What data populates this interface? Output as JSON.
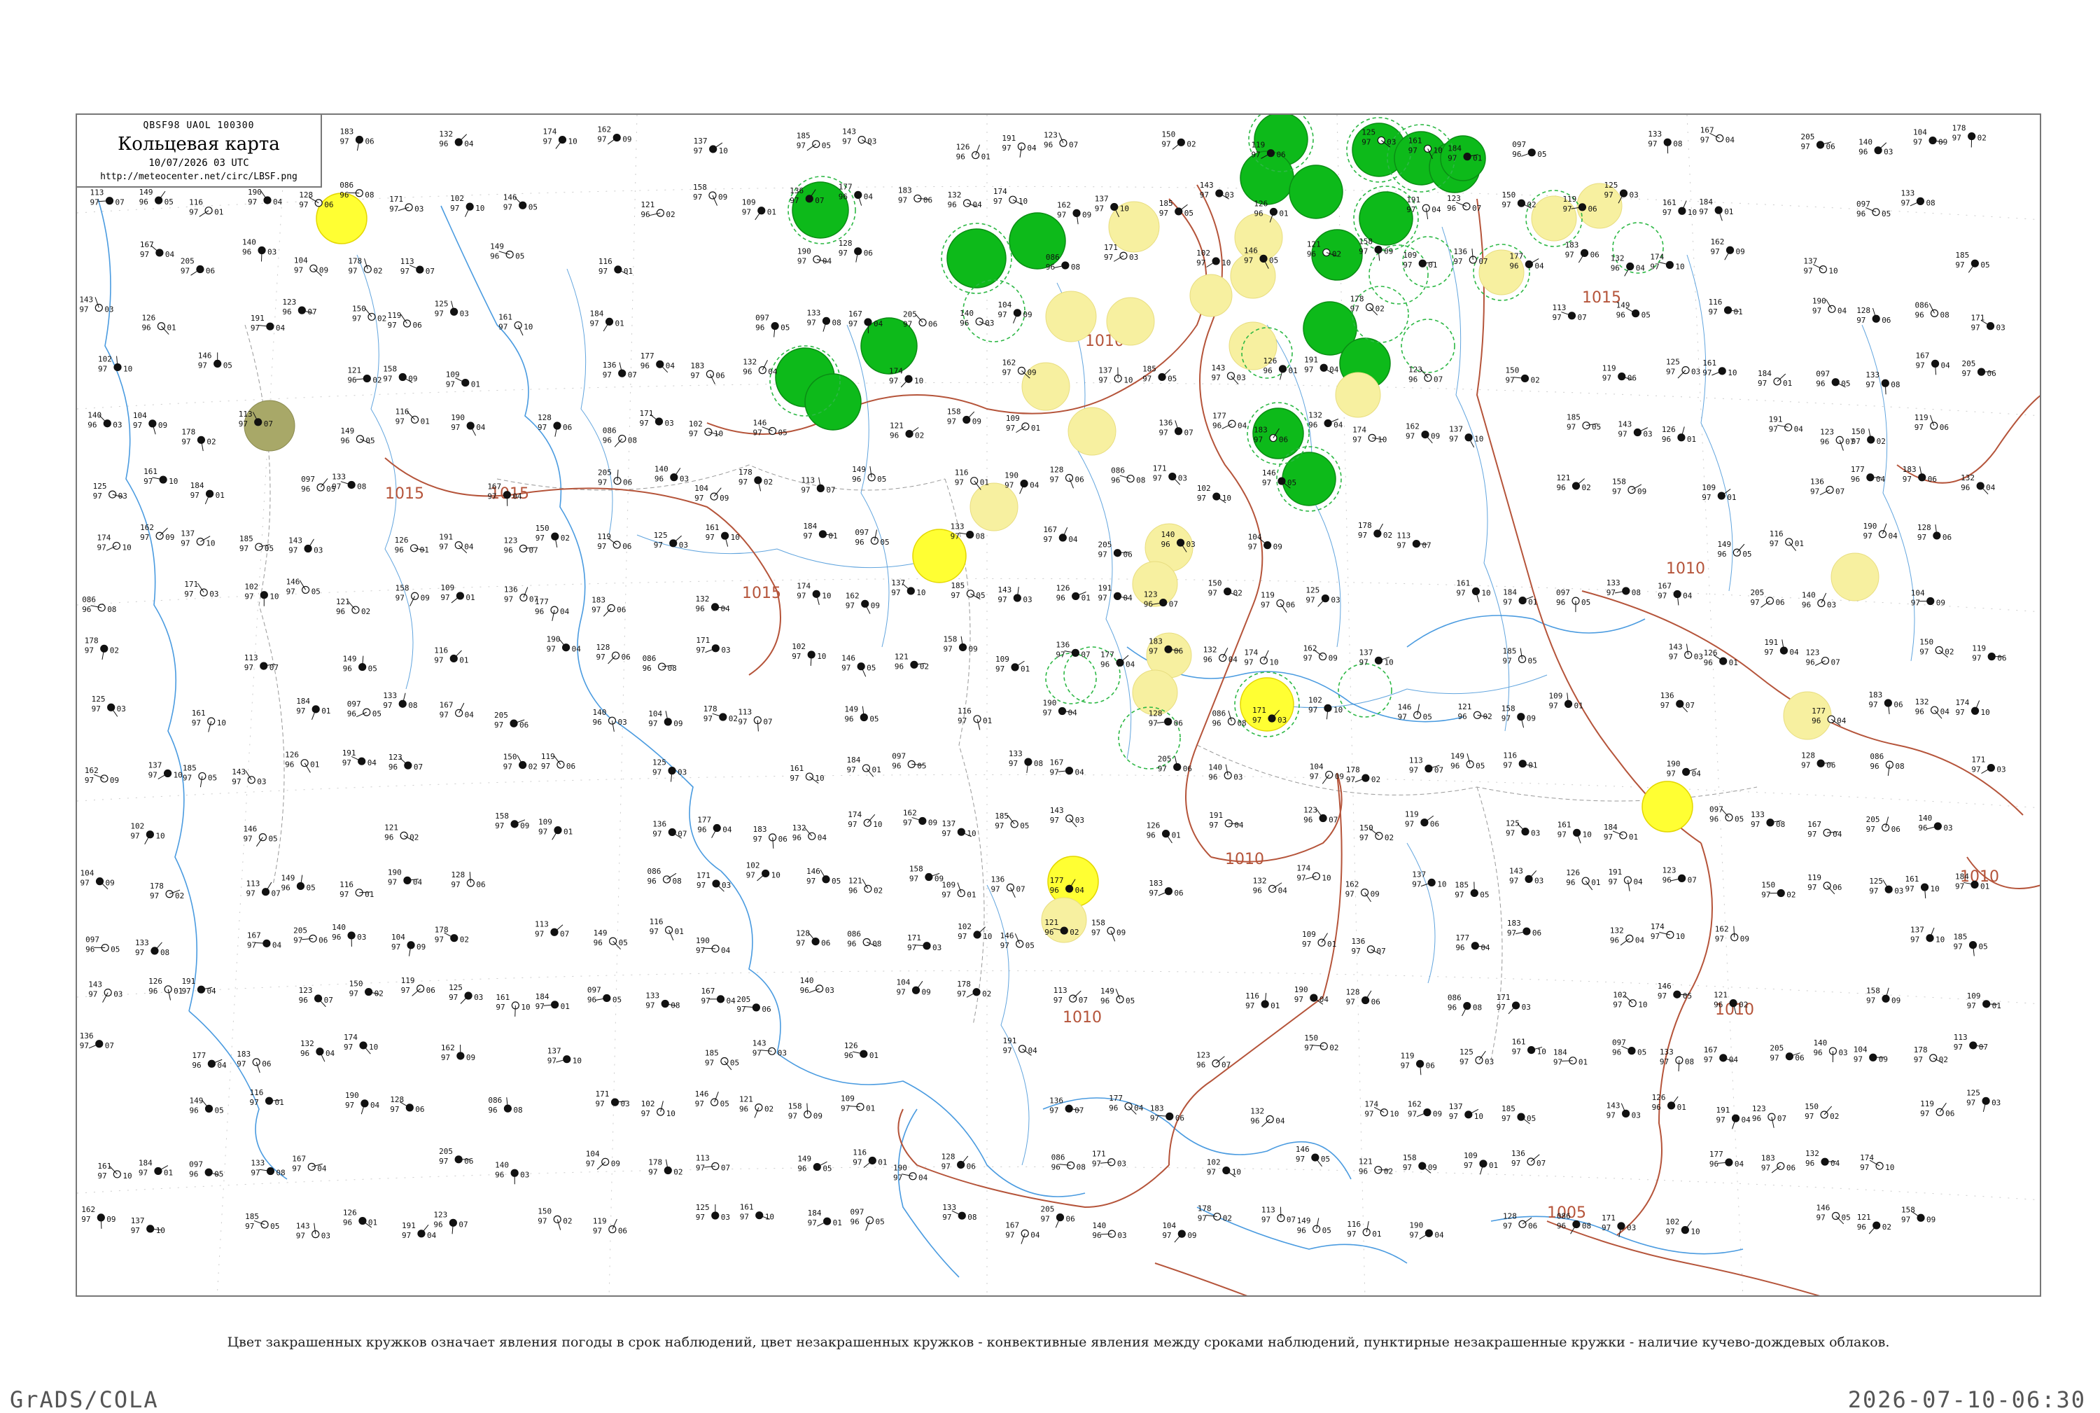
{
  "header": {
    "codes": "QBSF98  UAOL  100300",
    "title": "Кольцевая карта",
    "date": "10/07/2026 03 UTC",
    "url": "http://meteocenter.net/circ/LBSF.png"
  },
  "caption": "Цвет закрашенных кружков означает явления погоды в срок наблюдений, цвет незакрашенных кружков - конвективные явления между сроками наблюдений, пунктирные незакрашенные кружки - наличие кучево-дождевых облаков.",
  "footer": {
    "left": "GrADS/COLA",
    "right": "2026-07-10-06:30"
  },
  "colors": {
    "isobar": "#b5543a",
    "river": "#3b8fd6",
    "coast": "#4a9be0",
    "border": "#999999",
    "rain_fill": "#0dba1a",
    "fog_fill": "#ffff33",
    "haze_fill": "#f7f0a0",
    "cb_ring": "#2db845",
    "olive_fill": "#a8a868"
  },
  "isobar_labels": [
    "1015",
    "1015",
    "1010",
    "1015",
    "1010",
    "1010",
    "1015",
    "1010",
    "1010",
    "1005",
    "1010"
  ],
  "stations": [
    {
      "p": "183",
      "t": "97",
      "d": "06"
    },
    {
      "p": "132",
      "t": "96",
      "d": "04"
    },
    {
      "p": "174",
      "t": "97",
      "d": "10"
    },
    {
      "p": "162",
      "t": "97",
      "d": "09"
    },
    {
      "p": "137",
      "t": "97",
      "d": "10"
    },
    {
      "p": "185",
      "t": "97",
      "d": "05"
    },
    {
      "p": "143",
      "t": "97",
      "d": "03"
    },
    {
      "p": "126",
      "t": "96",
      "d": "01"
    },
    {
      "p": "191",
      "t": "97",
      "d": "04"
    },
    {
      "p": "123",
      "t": "96",
      "d": "07"
    },
    {
      "p": "150",
      "t": "97",
      "d": "02"
    },
    {
      "p": "119",
      "t": "97",
      "d": "06"
    },
    {
      "p": "125",
      "t": "97",
      "d": "03"
    },
    {
      "p": "161",
      "t": "97",
      "d": "10"
    },
    {
      "p": "184",
      "t": "97",
      "d": "01"
    },
    {
      "p": "097",
      "t": "96",
      "d": "05"
    },
    {
      "p": "133",
      "t": "97",
      "d": "08"
    },
    {
      "p": "167",
      "t": "97",
      "d": "04"
    },
    {
      "p": "205",
      "t": "97",
      "d": "06"
    },
    {
      "p": "140",
      "t": "96",
      "d": "03"
    },
    {
      "p": "104",
      "t": "97",
      "d": "09"
    },
    {
      "p": "178",
      "t": "97",
      "d": "02"
    },
    {
      "p": "113",
      "t": "97",
      "d": "07"
    },
    {
      "p": "149",
      "t": "96",
      "d": "05"
    },
    {
      "p": "116",
      "t": "97",
      "d": "01"
    },
    {
      "p": "190",
      "t": "97",
      "d": "04"
    },
    {
      "p": "128",
      "t": "97",
      "d": "06"
    },
    {
      "p": "086",
      "t": "96",
      "d": "08"
    },
    {
      "p": "171",
      "t": "97",
      "d": "03"
    },
    {
      "p": "102",
      "t": "97",
      "d": "10"
    },
    {
      "p": "146",
      "t": "97",
      "d": "05"
    },
    {
      "p": "121",
      "t": "96",
      "d": "02"
    },
    {
      "p": "158",
      "t": "97",
      "d": "09"
    },
    {
      "p": "109",
      "t": "97",
      "d": "01"
    },
    {
      "p": "136",
      "t": "97",
      "d": "07"
    },
    {
      "p": "177",
      "t": "96",
      "d": "04"
    }
  ]
}
